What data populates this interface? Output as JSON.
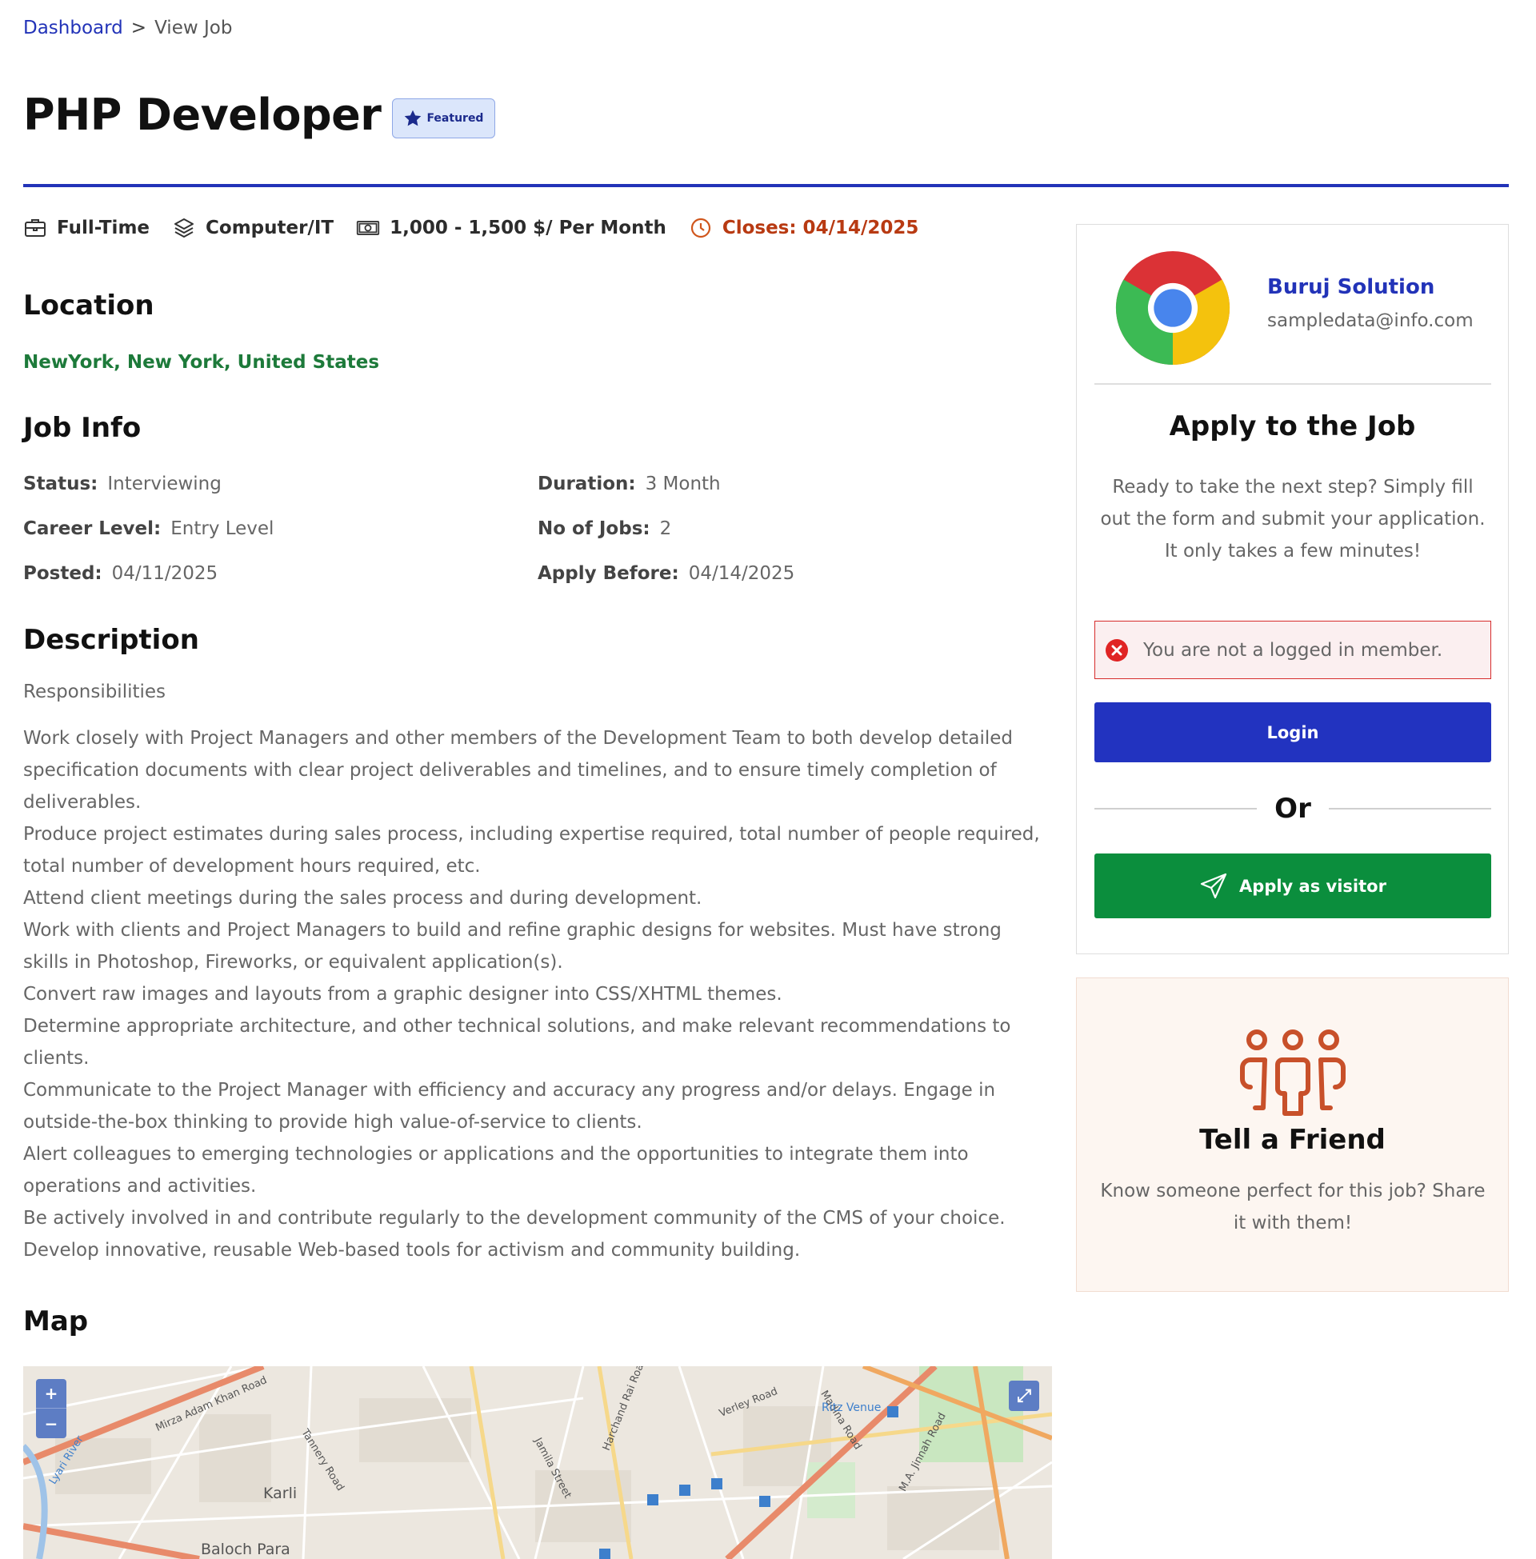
{
  "breadcrumb": {
    "home": "Dashboard",
    "separator": ">",
    "current": "View Job"
  },
  "job": {
    "title": "PHP Developer",
    "badge": "Featured",
    "meta": {
      "type": "Full-Time",
      "category": "Computer/IT",
      "salary": "1,000 - 1,500 $/ Per Month",
      "closes": "Closes: 04/14/2025"
    }
  },
  "sections": {
    "location": "Location",
    "job_info": "Job Info",
    "description": "Description",
    "map": "Map"
  },
  "location": "NewYork, New York, United States",
  "info": [
    {
      "label": "Status:",
      "value": "Interviewing"
    },
    {
      "label": "Duration:",
      "value": "3 Month"
    },
    {
      "label": "Career Level:",
      "value": "Entry Level"
    },
    {
      "label": "No of Jobs:",
      "value": "2"
    },
    {
      "label": "Posted:",
      "value": "04/11/2025"
    },
    {
      "label": "Apply Before:",
      "value": "04/14/2025"
    }
  ],
  "description": {
    "subheading": "Responsibilities",
    "items": [
      "Work closely with Project Managers and other members of the Development Team to both develop detailed specification documents with clear project deliverables and timelines, and to ensure timely completion of deliverables.",
      "Produce project estimates during sales process, including expertise required, total number of people required, total number of development hours required, etc.",
      "Attend client meetings during the sales process and during development.",
      "Work with clients and Project Managers to build and refine graphic designs for websites. Must have strong skills in Photoshop, Fireworks, or equivalent application(s).",
      "Convert raw images and layouts from a graphic designer into CSS/XHTML themes.",
      "Determine appropriate architecture, and other technical solutions, and make relevant recommendations to clients.",
      "Communicate to the Project Manager with efficiency and accuracy any progress and/or delays. Engage in outside-the-box thinking to provide high value-of-service to clients.",
      "Alert colleagues to emerging technologies or applications and the opportunities to integrate them into operations and activities.",
      "Be actively involved in and contribute regularly to the development community of the CMS of your choice.",
      "Develop innovative, reusable Web-based tools for activism and community building."
    ]
  },
  "map": {
    "zoom_in": "+",
    "zoom_out": "−",
    "fullscreen": "⤢",
    "labels": [
      "Karli",
      "Baloch Para",
      "Mirza Adam Khan Road",
      "Tannery Road",
      "Jamila Street",
      "Harchand Rai Road",
      "Verley Road",
      "Madina Road",
      "M.A. Jinnah Road",
      "Ritz Venue",
      "Lyari River"
    ]
  },
  "company": {
    "name": "Buruj Solution",
    "email": "sampledata@info.com"
  },
  "apply": {
    "heading": "Apply to the Job",
    "text": "Ready to take the next step? Simply fill out the form and submit your application. It only takes a few minutes!",
    "alert": "You are not a logged in member.",
    "login_label": "Login",
    "or_label": "Or",
    "visitor_label": "Apply as visitor"
  },
  "friend": {
    "heading": "Tell a Friend",
    "text": "Know someone perfect for this job? Share it with them!"
  },
  "colors": {
    "primary": "#2233b8",
    "success": "#0b8e3d",
    "danger": "#d62c2c",
    "closes": "#b83a12",
    "location": "#1d7a3a",
    "friend_icon": "#c8502a"
  }
}
